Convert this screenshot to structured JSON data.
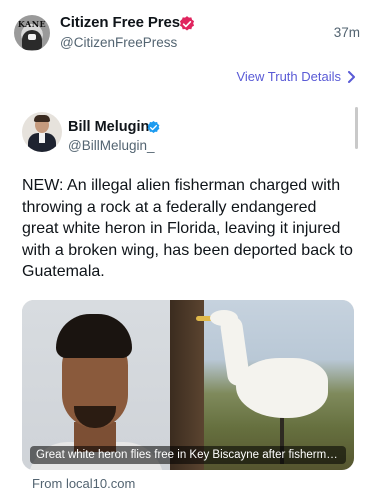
{
  "post": {
    "author_name": "Citizen Free Press",
    "author_handle": "@CitizenFreePress",
    "avatar_text": "KANE",
    "time": "37m",
    "truth_link_label": "View Truth Details",
    "verified_color": "#e0245e"
  },
  "quoted": {
    "author_name": "Bill Melugin",
    "author_handle": "@BillMelugin_",
    "verified_color": "#1d9bf0",
    "text": "NEW: An illegal alien fisherman charged with throwing a rock at a federally endangered great white heron in Florida, leaving it injured with a broken wing, has been deported back to Guatemala.",
    "media_caption": "Great white heron flies free in Key Biscayne after fisherma...",
    "source": "From local10.com"
  },
  "icons": {
    "chevron": "chevron-right-icon",
    "verified": "verified-badge-icon"
  }
}
